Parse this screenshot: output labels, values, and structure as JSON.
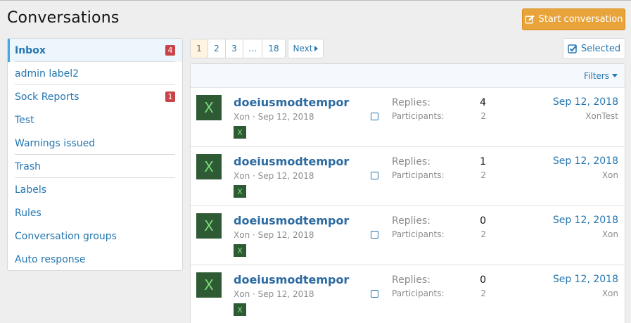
{
  "page": {
    "title": "Conversations"
  },
  "actions": {
    "start_label": "Start conversation",
    "selected_label": "Selected",
    "filters_label": "Filters"
  },
  "sidebar": {
    "items": [
      {
        "label": "Inbox",
        "count": "4"
      },
      {
        "label": "admin label2",
        "count": ""
      },
      {
        "label": "Sock Reports",
        "count": "1"
      },
      {
        "label": "Test",
        "count": ""
      },
      {
        "label": "Warnings issued",
        "count": ""
      },
      {
        "label": "Trash",
        "count": ""
      },
      {
        "label": "Labels",
        "count": ""
      },
      {
        "label": "Rules",
        "count": ""
      },
      {
        "label": "Conversation groups",
        "count": ""
      },
      {
        "label": "Auto response",
        "count": ""
      }
    ]
  },
  "pagination": {
    "pages": [
      "1",
      "2",
      "3",
      "…",
      "18"
    ],
    "current": "1",
    "next_label": "Next"
  },
  "list": {
    "replies_label": "Replies:",
    "participants_label": "Participants:",
    "rows": [
      {
        "avatar": "X",
        "title": "doeiusmodtempor",
        "author": "Xon",
        "sep": "·",
        "date": "Sep 12, 2018",
        "participant_avatar": "X",
        "replies": "4",
        "participants": "2",
        "last_date": "Sep 12, 2018",
        "last_user": "XonTest"
      },
      {
        "avatar": "X",
        "title": "doeiusmodtempor",
        "author": "Xon",
        "sep": "·",
        "date": "Sep 12, 2018",
        "participant_avatar": "X",
        "replies": "1",
        "participants": "2",
        "last_date": "Sep 12, 2018",
        "last_user": "Xon"
      },
      {
        "avatar": "X",
        "title": "doeiusmodtempor",
        "author": "Xon",
        "sep": "·",
        "date": "Sep 12, 2018",
        "participant_avatar": "X",
        "replies": "0",
        "participants": "2",
        "last_date": "Sep 12, 2018",
        "last_user": "Xon"
      },
      {
        "avatar": "X",
        "title": "doeiusmodtempor",
        "author": "Xon",
        "sep": "·",
        "date": "Sep 12, 2018",
        "participant_avatar": "X",
        "replies": "0",
        "participants": "2",
        "last_date": "Sep 12, 2018",
        "last_user": "Xon"
      }
    ]
  },
  "colors": {
    "accent": "#2577b1",
    "button_orange": "#e8a43a",
    "badge_red": "#c84448",
    "avatar_green": "#2e5b33"
  },
  "icons": {
    "start": "compose-icon",
    "selected": "checkbox-checked-icon",
    "filters": "caret-down-icon"
  }
}
